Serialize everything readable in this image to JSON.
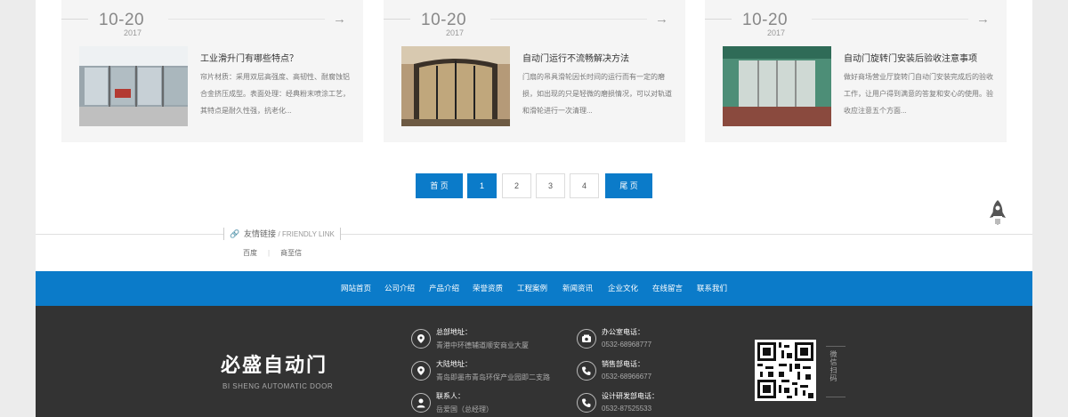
{
  "cards": [
    {
      "day": "10-20",
      "year": "2017",
      "title": "工业滑升门有哪些特点？",
      "desc": "帘片材质：采用双层高强度、高韧性、耐腐蚀铝合金挤压成型。表面处理：经典粉末喷涂工艺，其特点是耐久性强，抗老化..."
    },
    {
      "day": "10-20",
      "year": "2017",
      "title": "自动门运行不流畅解决方法",
      "desc": "门扇的吊具滑轮因长时间的运行而有一定的磨损，如出现的只是轻微的磨损情况，可以对轨道和滑轮进行一次清理..."
    },
    {
      "day": "10-20",
      "year": "2017",
      "title": "自动门旋转门安装后验收注意事项",
      "desc": "做好商场营业厅旋转门自动门安装完成后的验收工作，让用户得到满意的答复和安心的使用。验收应注意五个方面..."
    }
  ],
  "pager": {
    "first": "首 页",
    "pages": [
      "1",
      "2",
      "3",
      "4"
    ],
    "current": "1",
    "last": "尾 页"
  },
  "friendly_link": {
    "title": "友情链接",
    "title_en": "/ FRIENDLY LINK",
    "links": [
      "百度",
      "商至信"
    ]
  },
  "nav": [
    "网站首页",
    "公司介绍",
    "产品介绍",
    "荣誉资质",
    "工程案例",
    "新闻资讯",
    "企业文化",
    "在线留言",
    "联系我们"
  ],
  "footer": {
    "logo_cn": "必盛自动门",
    "logo_en": "BI SHENG AUTOMATIC DOOR",
    "contacts": [
      {
        "label": "总部地址：",
        "value": "青港中环德辅道顺安商业大厦",
        "icon": "location-icon"
      },
      {
        "label": "大陆地址：",
        "value": "青岛即墨市青岛环保产业园即二支路",
        "icon": "location-icon"
      },
      {
        "label": "联系人：",
        "value": "岳爱国（总经理）",
        "icon": "person-icon"
      },
      {
        "label": "办公室电话：",
        "value": "0532-68968777",
        "icon": "phone-icon"
      },
      {
        "label": "销售部电话：",
        "value": "0532-68966677",
        "icon": "phone-icon"
      },
      {
        "label": "设计研发部电话：",
        "value": "0532-87525533",
        "icon": "phone-icon"
      }
    ],
    "qr_label": "微信扫码"
  },
  "colors": {
    "accent": "#0b7bc9",
    "footer_bg": "#333333"
  }
}
